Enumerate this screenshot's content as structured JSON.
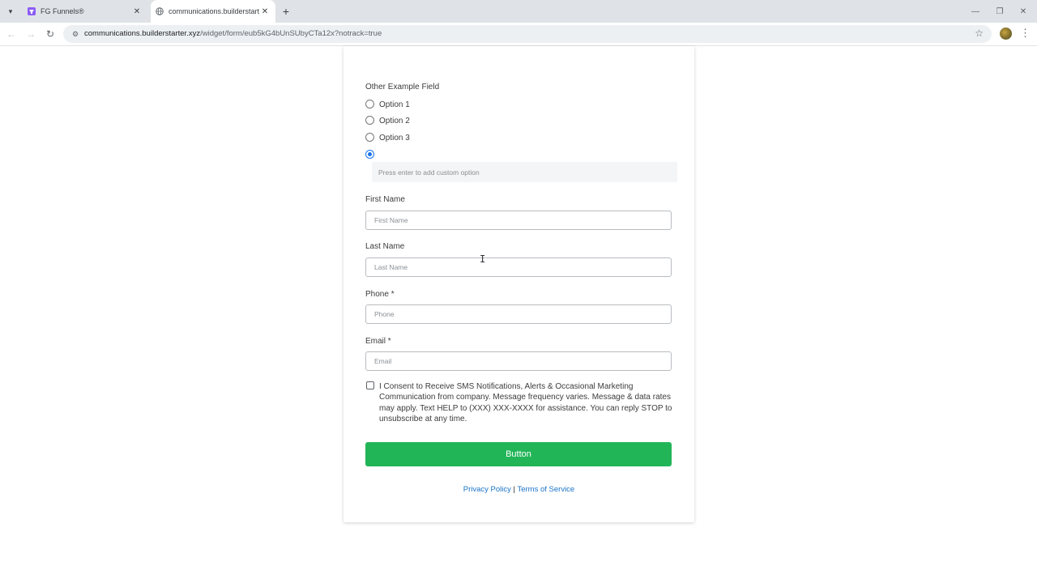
{
  "browser": {
    "tabs": [
      {
        "title": "FG Funnels®",
        "active": false
      },
      {
        "title": "communications.builderstarter.xyz",
        "active": true
      }
    ],
    "address": {
      "host": "communications.builderstarter.xyz",
      "path": "/widget/form/eub5kG4bUnSUbyCTa12x?notrack=true"
    },
    "icons": {
      "tab_search": "chevron-down-icon",
      "tab_close": "close-icon",
      "new_tab": "plus-icon",
      "back": "arrow-left-icon",
      "forward": "arrow-right-icon",
      "reload": "reload-icon",
      "site_info": "tune-icon",
      "bookmark": "star-icon",
      "menu": "kebab-menu-icon"
    }
  },
  "form": {
    "radio_field": {
      "label": "Other Example Field",
      "options": [
        {
          "label": "Option 1",
          "checked": false
        },
        {
          "label": "Option 2",
          "checked": false
        },
        {
          "label": "Option 3",
          "checked": false
        },
        {
          "label": "",
          "checked": true
        }
      ],
      "custom_placeholder": "Press enter to add custom option"
    },
    "first_name": {
      "label": "First Name",
      "placeholder": "First Name"
    },
    "last_name": {
      "label": "Last Name",
      "placeholder": "Last Name"
    },
    "phone": {
      "label": "Phone *",
      "placeholder": "Phone"
    },
    "email": {
      "label": "Email *",
      "placeholder": "Email"
    },
    "consent_text": "I Consent to Receive SMS Notifications, Alerts & Occasional Marketing Communication from company. Message frequency varies. Message & data rates may apply. Text HELP to (XXX) XXX-XXXX for assistance. You can reply STOP to unsubscribe at any time.",
    "submit_label": "Button",
    "footer": {
      "privacy": "Privacy Policy",
      "separator": "|",
      "terms": "Terms of Service"
    }
  },
  "colors": {
    "button": "#22b558",
    "link": "#1a73c9",
    "radio_checked": "#1a73e8"
  }
}
